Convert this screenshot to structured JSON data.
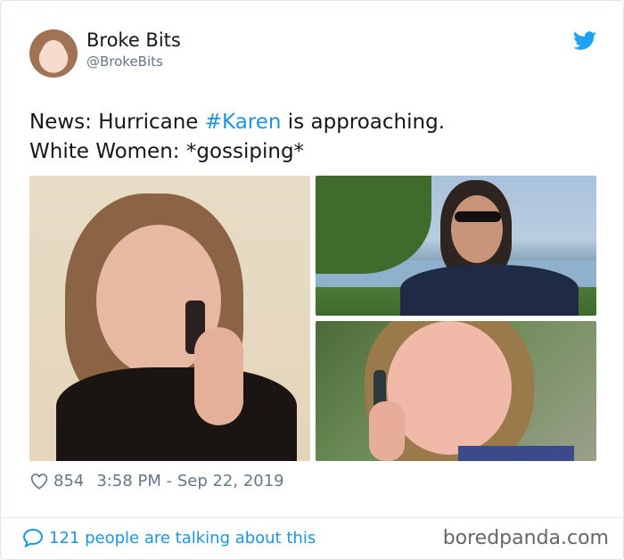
{
  "tweet": {
    "display_name": "Broke Bits",
    "handle": "@BrokeBits",
    "text_line1_before": "News: Hurricane ",
    "hashtag": "#Karen",
    "text_line1_after": " is approaching.",
    "text_line2": "White Women: *gossiping*",
    "likes": "854",
    "timestamp": "3:58 PM - Sep 22, 2019",
    "talking": "121 people are talking about this"
  },
  "watermark": "boredpanda.com",
  "icons": {
    "brand": "twitter-bird-icon",
    "like": "heart-icon",
    "reply": "speech-bubble-icon"
  },
  "colors": {
    "link": "#1b95e0",
    "muted": "#657786",
    "text": "#14171a",
    "border": "#e1e8ed"
  }
}
